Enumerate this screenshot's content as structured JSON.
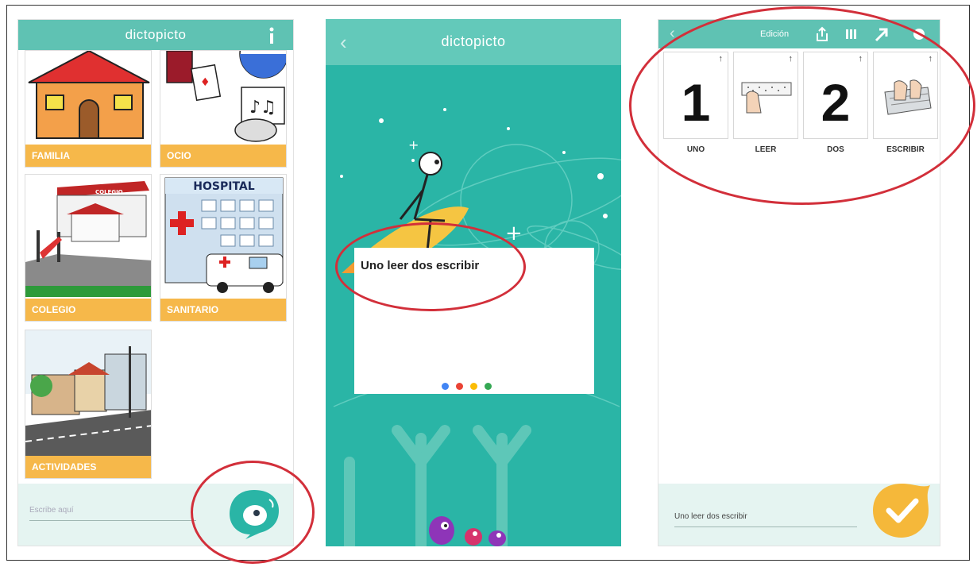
{
  "screens": {
    "left": {
      "brand": "dictopicto",
      "categories": [
        {
          "label": "FAMILIA",
          "icon": "house-icon"
        },
        {
          "label": "OCIO",
          "icon": "leisure-icon"
        },
        {
          "label": "COLEGIO",
          "icon": "school-icon"
        },
        {
          "label": "SANITARIO",
          "icon": "hospital-icon"
        },
        {
          "label": "ACTIVIDADES",
          "icon": "street-icon"
        }
      ],
      "hospital_sign": "HOSPITAL",
      "school_sign": "COLEGIO",
      "input_placeholder": "Escribe aquí",
      "button_icon": "speech-bubble-bird-icon"
    },
    "middle": {
      "brand": "dictopicto",
      "recognized_text": "Uno leer dos escribir",
      "dot_colors": [
        "#4285f4",
        "#ea4335",
        "#fbbc05",
        "#34a853"
      ]
    },
    "right": {
      "edit_label": "Edición",
      "pictos": [
        {
          "word": "UNO",
          "number": "1"
        },
        {
          "word": "LEER",
          "icon": "reading-braille-icon"
        },
        {
          "word": "DOS",
          "number": "2"
        },
        {
          "word": "ESCRIBIR",
          "icon": "typing-keyboard-icon"
        }
      ],
      "input_value": "Uno leer dos escribir",
      "button_icon": "checkmark-icon"
    }
  },
  "colors": {
    "teal_bar": "#5fc2b3",
    "teal_bg": "#2ab5a6",
    "label_orange": "#f6b84a",
    "annotation_red": "#d22f3a"
  }
}
